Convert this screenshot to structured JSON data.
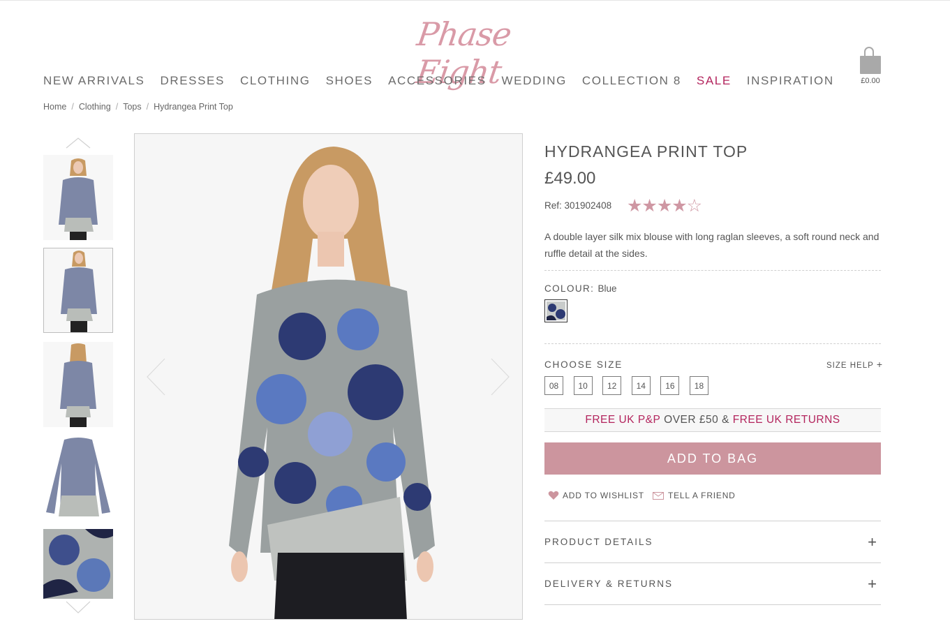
{
  "brand": {
    "logo_text": "Phase Eight",
    "accent": "#d99aa7"
  },
  "nav": {
    "items": [
      {
        "label": "NEW ARRIVALS"
      },
      {
        "label": "DRESSES"
      },
      {
        "label": "CLOTHING"
      },
      {
        "label": "SHOES"
      },
      {
        "label": "ACCESSORIES"
      },
      {
        "label": "WEDDING"
      },
      {
        "label": "COLLECTION 8"
      },
      {
        "label": "SALE",
        "color": "#b3245d"
      },
      {
        "label": "INSPIRATION"
      }
    ]
  },
  "bag": {
    "total": "£0.00",
    "icon": "shopping-bag-icon"
  },
  "breadcrumb": [
    "Home",
    "Clothing",
    "Tops",
    "Hydrangea Print Top"
  ],
  "gallery": {
    "thumbnails": [
      {
        "view": "front"
      },
      {
        "view": "front-full",
        "active": true
      },
      {
        "view": "back"
      },
      {
        "view": "flat"
      },
      {
        "view": "detail"
      }
    ]
  },
  "product": {
    "title": "HYDRANGEA PRINT TOP",
    "price": "£49.00",
    "ref_label": "Ref: 301902408",
    "rating": 4,
    "rating_max": 5,
    "stars_text": "★★★★☆",
    "description": "A double layer silk mix blouse with long raglan sleeves, a soft round neck and ruffle detail at the sides.",
    "colour_label": "COLOUR:",
    "colour_value": "Blue",
    "size_label": "CHOOSE SIZE",
    "size_help": "SIZE HELP",
    "size_help_icon": "+",
    "sizes": [
      "08",
      "10",
      "12",
      "14",
      "16",
      "18"
    ],
    "promo": {
      "part1": "FREE UK P&P",
      "part2": " OVER £50 & ",
      "part3": "FREE UK RETURNS"
    },
    "add_to_bag": "ADD TO BAG",
    "add_to_wishlist": "ADD TO WISHLIST",
    "tell_a_friend": "TELL A FRIEND",
    "accordion": [
      {
        "label": "PRODUCT DETAILS",
        "icon": "+"
      },
      {
        "label": "DELIVERY & RETURNS",
        "icon": "+"
      }
    ],
    "button_color": "#cc959e"
  }
}
